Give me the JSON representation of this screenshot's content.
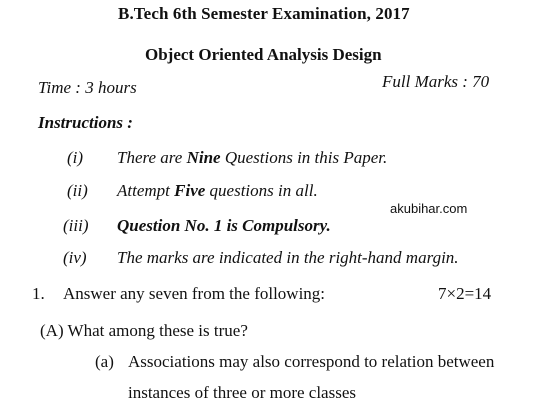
{
  "header": {
    "exam_title": "B.Tech 6th Semester Examination, 2017",
    "subject": "Object Oriented Analysis Design",
    "time": "Time : 3 hours",
    "full_marks": "Full Marks : 70"
  },
  "instructions": {
    "heading": "Instructions :",
    "items": [
      {
        "num": "(i)",
        "pre": "There are ",
        "bold": "Nine",
        "post": " Questions in this Paper."
      },
      {
        "num": "(ii)",
        "pre": "Attempt ",
        "bold": "Five",
        "post": " questions in all."
      },
      {
        "num": "(iii)",
        "pre": "",
        "bold": "Question No. 1 is Compulsory.",
        "post": ""
      },
      {
        "num": "(iv)",
        "pre": "The marks are indicated in the right-hand margin.",
        "bold": "",
        "post": ""
      }
    ]
  },
  "watermark": "akubihar.com",
  "question1": {
    "num": "1.",
    "text": "Answer any seven from the following:",
    "marks": "7×2=14",
    "sub_a": "(A) What among these is true?",
    "option_a_label": "(a)",
    "option_a_line1": "Associations may also correspond to relation between",
    "option_a_line2": "instances of three or more classes"
  }
}
